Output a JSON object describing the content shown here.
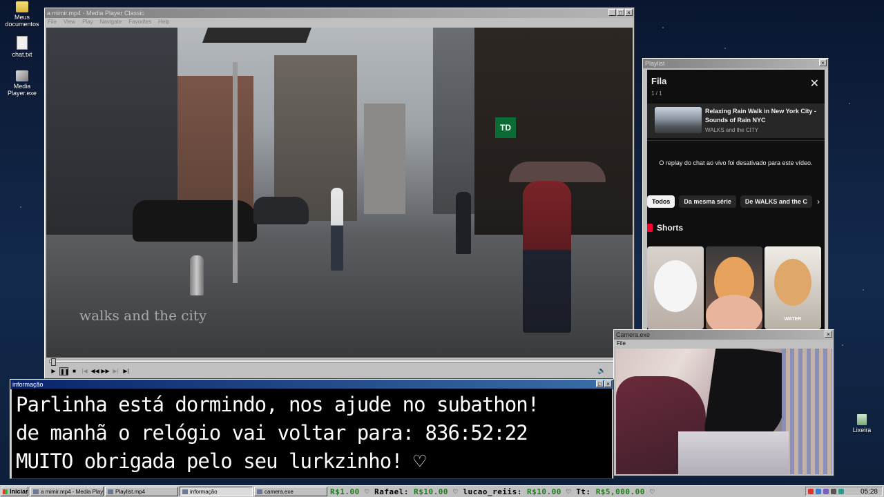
{
  "desktop": {
    "icons": [
      {
        "label": "Meus documentos"
      },
      {
        "label": "chat.txt"
      },
      {
        "label": "Media Player.exe"
      },
      {
        "label": "Lixeira"
      }
    ]
  },
  "player": {
    "title": "a mimir.mp4 - Media Player Classic",
    "menu": [
      "File",
      "View",
      "Play",
      "Navigate",
      "Favorites",
      "Help"
    ],
    "seek_fraction": 0.002,
    "video_watermark": "walks and the city",
    "controls": [
      "play",
      "pause",
      "stop",
      "previous",
      "rewind",
      "forward",
      "next",
      "frame-step"
    ]
  },
  "playlist": {
    "window_title": "Playlist",
    "header": "Fila",
    "count": "1 / 1",
    "item": {
      "title": "Relaxing Rain Walk in New York City - Sounds of Rain NYC",
      "channel": "WALKS and the CITY"
    },
    "replay_message": "O replay do chat ao vivo foi desativado para este vídeo.",
    "chips": [
      "Todos",
      "Da mesma série",
      "De WALKS and the C"
    ],
    "shorts_label": "Shorts",
    "short_caption": "WATER"
  },
  "camera": {
    "title": "Camera.exe",
    "menu": [
      "File"
    ]
  },
  "info": {
    "title": "informação",
    "lines": [
      "Parlinha está dormindo, nos ajude no subathon!",
      "de manhã o relógio vai voltar para:  836:52:22",
      "MUITO obrigada pelo seu lurkzinho! ♡"
    ]
  },
  "taskbar": {
    "start": "Iniciar",
    "tasks": [
      {
        "label": "a mimir.mp4 - Media Playe..."
      },
      {
        "label": "Playlist.mp4"
      },
      {
        "label": "informação"
      },
      {
        "label": "camera.exe"
      }
    ],
    "ticker": [
      {
        "name": "",
        "amount": "R$1.00"
      },
      {
        "name": "Rafael:",
        "amount": "R$10.00"
      },
      {
        "name": "lucao_reiis:",
        "amount": "R$10.00"
      },
      {
        "name": "Tt:",
        "amount": "R$5,000.00"
      }
    ],
    "clock": "05:28"
  },
  "colors": {
    "title_active": "#0a246a",
    "youtube_bg": "#0f0f0f",
    "shorts_red": "#ff0033",
    "ticker_money": "#1d7a1d"
  }
}
